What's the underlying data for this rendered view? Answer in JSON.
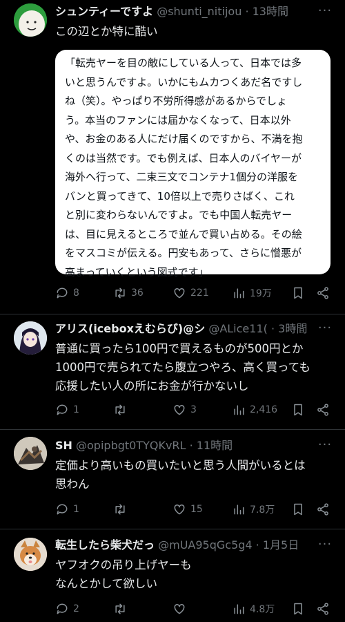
{
  "tweets": [
    {
      "name": "シュンティーですよ",
      "handle": "@shunti_nitijou",
      "time": "13時間",
      "text": "この辺とか特に酷い",
      "quote": "「転売ヤーを目の敵にしている人って、日本では多\nいと思うんですよ。いかにもムカつくあだ名ですし\nね（笑）。やっぱり不労所得感があるからでしょ\nう。本当のファンには届かなくなって、日本以外\nや、お金のある人にだけ届くのですから、不満を抱\nくのは当然です。でも例えば、日本人のバイヤーが\n海外へ行って、二束三文でコンテナ1個分の洋服を\nバンと買ってきて、10倍以上で売りさばく、これ\nと別に変わらないんですよ。でも中国人転売ヤー\nは、目に見えるところで並んで買い占める。その絵\nをマスコミが伝える。円安もあって、さらに憎悪が\n高まっていくという図式です」",
      "replies": "8",
      "retweets": "36",
      "likes": "221",
      "views": "19万"
    },
    {
      "name": "アリス(iceboxえむらび)@シ",
      "handle": "@ALice11(",
      "time": "3時間",
      "text": "普通に買ったら100円で買えるものが500円とか\n1000円で売られてたら腹立つやろ、高く買っても\n応援したい人の所にお金が行かないし",
      "replies": "1",
      "retweets": "",
      "likes": "3",
      "views": "2,416"
    },
    {
      "name": "SH",
      "handle": "@opipbgt0TYQKvRL",
      "time": "11時間",
      "text": "定価より高いもの買いたいと思う人間がいるとは\n思わん",
      "replies": "1",
      "retweets": "",
      "likes": "15",
      "views": "7.8万"
    },
    {
      "name": "転生したら柴犬だっ",
      "handle": "@mUA95qGc5g4",
      "time": "1月5日",
      "text": "ヤフオクの吊り上げヤーも\nなんとかして欲しい",
      "replies": "2",
      "retweets": "",
      "likes": "",
      "views": "4.8万"
    }
  ],
  "separator": "·",
  "more_glyph": "···",
  "icons": [
    "reply-icon",
    "retweet-icon",
    "like-icon",
    "views-icon",
    "bookmark-icon",
    "share-icon"
  ],
  "colors": {
    "background": "#000000",
    "text": "#e7e9ea",
    "muted": "#71767b",
    "divider": "#2f3336",
    "card": "#ffffff"
  }
}
